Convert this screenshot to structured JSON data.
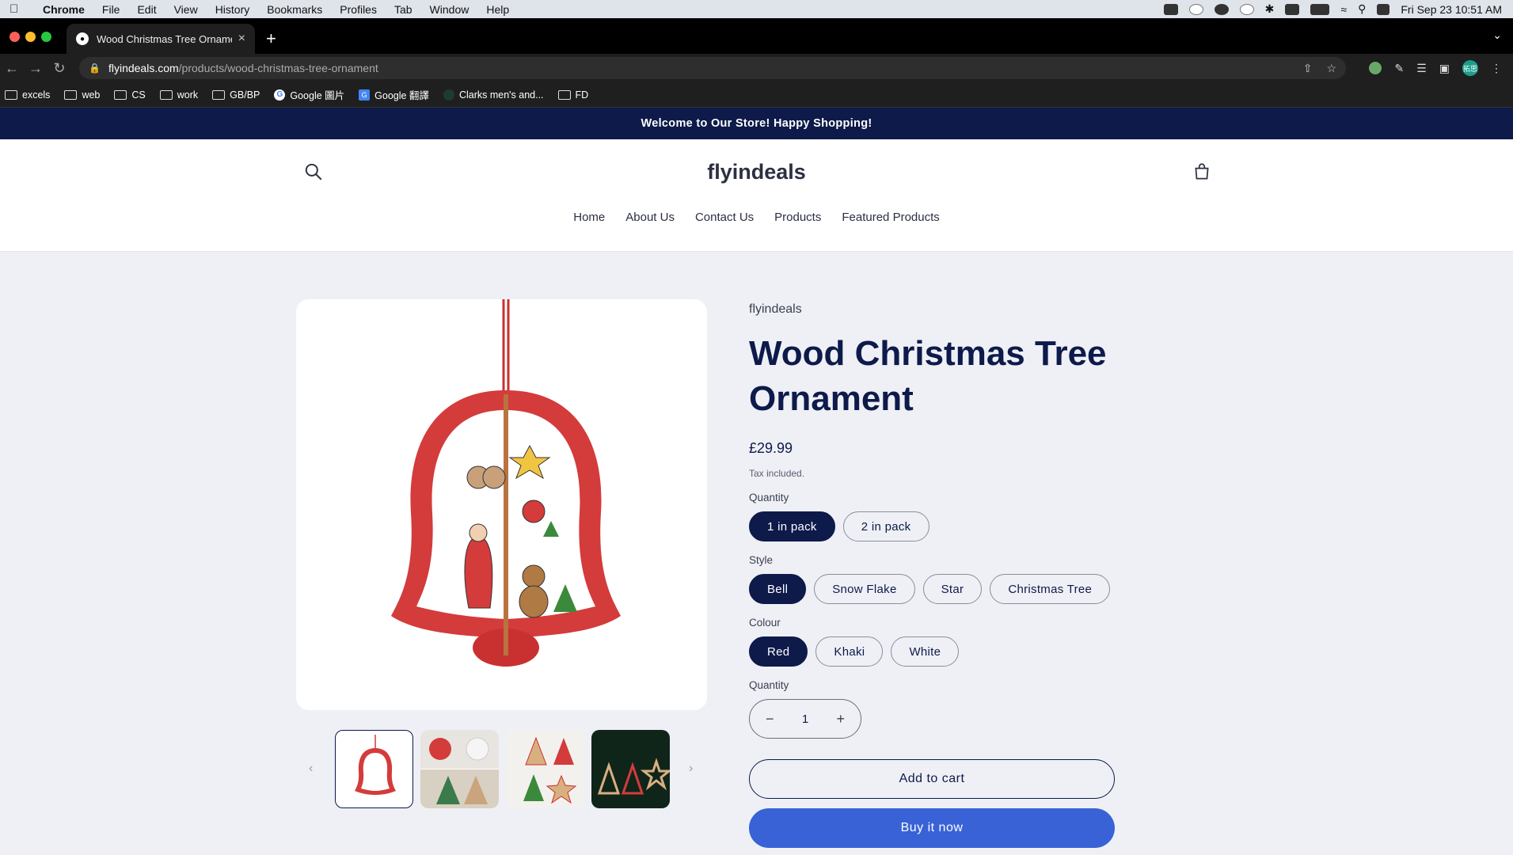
{
  "menubar": {
    "app": "Chrome",
    "items": [
      "File",
      "Edit",
      "View",
      "History",
      "Bookmarks",
      "Profiles",
      "Tab",
      "Window",
      "Help"
    ],
    "clock": "Fri Sep 23  10:51 AM"
  },
  "browser": {
    "tab_title": "Wood Christmas Tree Ornament",
    "url_host": "flyindeals.com",
    "url_path": "/products/wood-christmas-tree-ornament",
    "profile_initials": "拓思",
    "bookmarks": [
      "excels",
      "web",
      "CS",
      "work",
      "GB/BP",
      "Google 圖片",
      "Google 翻譯",
      "Clarks men's and...",
      "FD"
    ]
  },
  "store": {
    "announcement": "Welcome to Our Store! Happy Shopping!",
    "logo": "flyindeals",
    "nav": [
      "Home",
      "About Us",
      "Contact Us",
      "Products",
      "Featured Products"
    ]
  },
  "product": {
    "vendor": "flyindeals",
    "title": "Wood Christmas Tree Ornament",
    "price": "£29.99",
    "tax_note": "Tax included.",
    "options": {
      "pack_label": "Quantity",
      "pack_values": [
        "1 in pack",
        "2 in pack"
      ],
      "style_label": "Style",
      "style_values": [
        "Bell",
        "Snow Flake",
        "Star",
        "Christmas Tree"
      ],
      "colour_label": "Colour",
      "colour_values": [
        "Red",
        "Khaki",
        "White"
      ]
    },
    "quantity_label": "Quantity",
    "quantity_value": "1",
    "add_to_cart": "Add to cart",
    "buy_now": "Buy it now"
  },
  "colors": {
    "brand_navy": "#0d1a4a",
    "buy_blue": "#3862d6",
    "ornament_red": "#d43b3b"
  }
}
